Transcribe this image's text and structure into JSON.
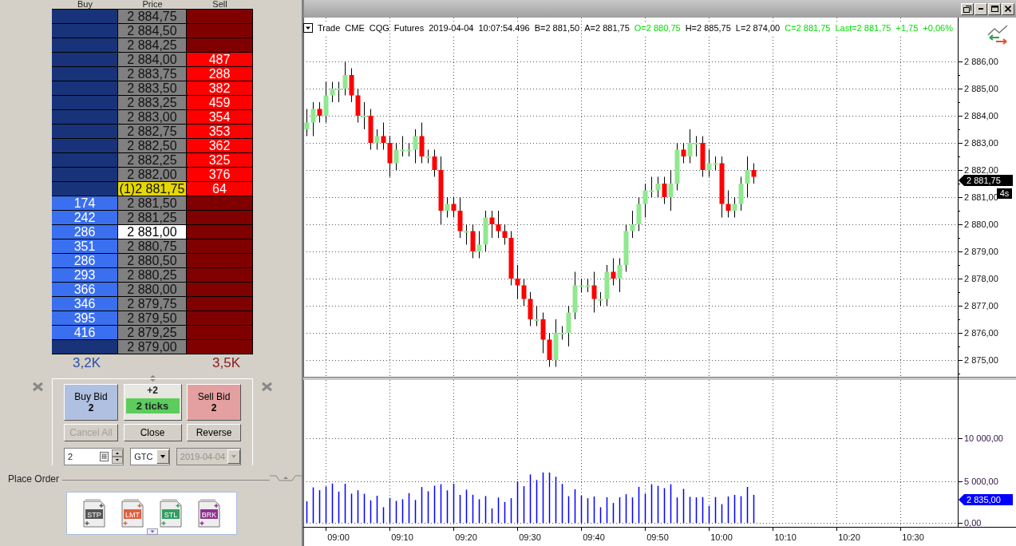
{
  "ladder": {
    "headers": [
      "Buy",
      "Price",
      "Sell"
    ],
    "rows": [
      {
        "price": "2 884,75"
      },
      {
        "price": "2 884,50"
      },
      {
        "price": "2 884,25"
      },
      {
        "price": "2 884,00",
        "sell": "487"
      },
      {
        "price": "2 883,75",
        "sell": "288"
      },
      {
        "price": "2 883,50",
        "sell": "382"
      },
      {
        "price": "2 883,25",
        "sell": "459"
      },
      {
        "price": "2 883,00",
        "sell": "354"
      },
      {
        "price": "2 882,75",
        "sell": "353"
      },
      {
        "price": "2 882,50",
        "sell": "362"
      },
      {
        "price": "2 882,25",
        "sell": "325"
      },
      {
        "price": "2 882,00",
        "sell": "376"
      },
      {
        "price": "(1)2 881,75",
        "kind": "last",
        "sell": "64"
      },
      {
        "price": "2 881,50",
        "buy": "174"
      },
      {
        "price": "2 881,25",
        "buy": "242"
      },
      {
        "price": "2 881,00",
        "kind": "highlight",
        "buy": "286"
      },
      {
        "price": "2 880,75",
        "buy": "351"
      },
      {
        "price": "2 880,50",
        "buy": "286"
      },
      {
        "price": "2 880,25",
        "buy": "293"
      },
      {
        "price": "2 880,00",
        "buy": "366"
      },
      {
        "price": "2 879,75",
        "buy": "346"
      },
      {
        "price": "2 879,50",
        "buy": "395"
      },
      {
        "price": "2 879,25",
        "buy": "416"
      },
      {
        "price": "2 879,00"
      }
    ],
    "totals": {
      "buy": "3,2K",
      "sell": "3,5K"
    }
  },
  "order_panel": {
    "buy_button": {
      "label": "Buy Bid",
      "quantity": "2"
    },
    "offset": {
      "value": "+2",
      "ticks": "2 ticks"
    },
    "sell_button": {
      "label": "Sell Bid",
      "quantity": "2"
    },
    "buttons": [
      {
        "label": "Cancel All",
        "disabled": true
      },
      {
        "label": "Close",
        "disabled": false
      },
      {
        "label": "Reverse",
        "disabled": false
      }
    ],
    "quantity": "2",
    "duration": "GTC",
    "date": {
      "value": "2019-04-04",
      "disabled": true
    }
  },
  "place_order": {
    "title": "Place Order",
    "order_types": [
      "STP",
      "LMT",
      "STL",
      "BRK"
    ]
  },
  "chart": {
    "quote": [
      {
        "text": "Trade",
        "kind": "plain"
      },
      {
        "text": "CME",
        "kind": "plain"
      },
      {
        "text": "CQG",
        "kind": "plain"
      },
      {
        "text": "Futures",
        "kind": "plain"
      },
      {
        "text": "2019-04-04",
        "kind": "plain"
      },
      {
        "text": "10:07:54.496",
        "kind": "plain"
      },
      {
        "text": "B=2 881,50",
        "kind": "plain"
      },
      {
        "text": "A=2 881,75",
        "kind": "plain"
      },
      {
        "text": "O=2 880,75",
        "kind": "up"
      },
      {
        "text": "H=2 885,75",
        "kind": "plain"
      },
      {
        "text": "L=2 874,00",
        "kind": "plain"
      },
      {
        "text": "C=2 881,75",
        "kind": "up"
      },
      {
        "text": "Last=2 881,75",
        "kind": "up"
      },
      {
        "text": "+1,75",
        "kind": "up"
      },
      {
        "text": "+0,06%",
        "kind": "up"
      }
    ],
    "price_axis": [
      "2 886,00",
      "2 885,00",
      "2 884,00",
      "2 883,00",
      "2 882,00",
      "2 881,00",
      "2 880,00",
      "2 879,00",
      "2 878,00",
      "2 877,00",
      "2 876,00",
      "2 875,00"
    ],
    "last_price": "2 881,75",
    "timer": "4s",
    "volume_axis": [
      "10 000,00",
      "5 000,00",
      "0,00"
    ],
    "last_volume": "2 835,00",
    "time_axis": [
      "09:00",
      "09:10",
      "09:20",
      "09:30",
      "09:40",
      "09:50",
      "10:00",
      "10:10",
      "10:20",
      "10:30"
    ]
  }
}
